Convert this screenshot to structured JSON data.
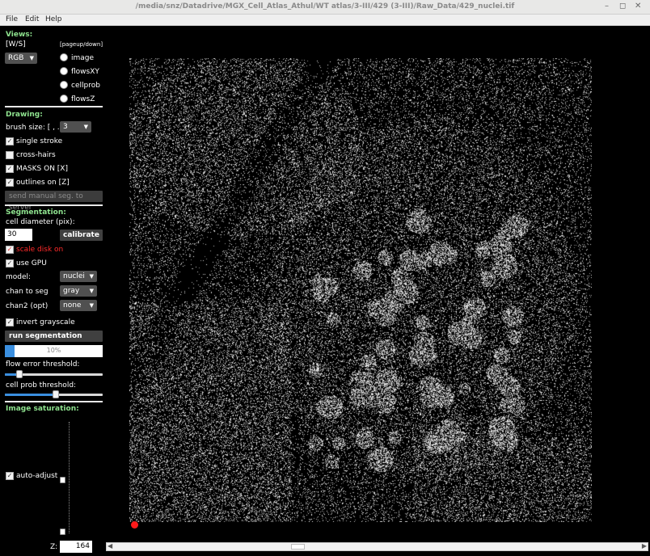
{
  "window": {
    "title": "/media/snz/Datadrive/MGX_Cell_Atlas_Athul/WT atlas/3-III/429 (3-III)/Raw_Data/429_nuclei.tif"
  },
  "menu": [
    "File",
    "Edit",
    "Help"
  ],
  "views": {
    "header": "Views:",
    "ws_hint": "[W/S]",
    "pageupdown_hint": "[pageup/down]",
    "color_mode": "RGB",
    "radios": [
      "image",
      "flowsXY",
      "cellprob",
      "flowsZ"
    ]
  },
  "drawing": {
    "header": "Drawing:",
    "brush_label": "brush size: [ , . ]",
    "brush_value": "3",
    "single_stroke": "single stroke",
    "crosshairs": "cross-hairs",
    "masks_on": "MASKS ON [X]",
    "outlines_on": "outlines on [Z]",
    "send_button": "send manual seg. to server"
  },
  "segmentation": {
    "header": "Segmentation:",
    "diameter_label": "cell diameter (pix):",
    "diameter_value": "30",
    "calibrate": "calibrate",
    "scale_disk": "scale disk on",
    "use_gpu": "use GPU",
    "model_label": "model:",
    "model_value": "nuclei",
    "chan_label": "chan to seg",
    "chan_value": "gray",
    "chan2_label": "chan2 (opt)",
    "chan2_value": "none",
    "invert": "invert grayscale",
    "run_button": "run segmentation",
    "progress_text": "10%",
    "progress_fraction": 0.1,
    "flow_label": "flow error threshold:",
    "flow_fraction": 0.12,
    "cellprob_label": "cell prob threshold:",
    "cellprob_fraction": 0.5
  },
  "saturation": {
    "header": "Image saturation:",
    "auto_adjust": "auto-adjust"
  },
  "z": {
    "label": "Z:",
    "value": "164"
  },
  "colors": {
    "header_green": "#8fe38f",
    "accent_blue": "#3a8fe0",
    "marker_red": "#ff1a1a"
  },
  "icons": [
    "check-icon",
    "caret-down-icon",
    "scroll-left-icon",
    "scroll-right-icon",
    "close-icon"
  ]
}
